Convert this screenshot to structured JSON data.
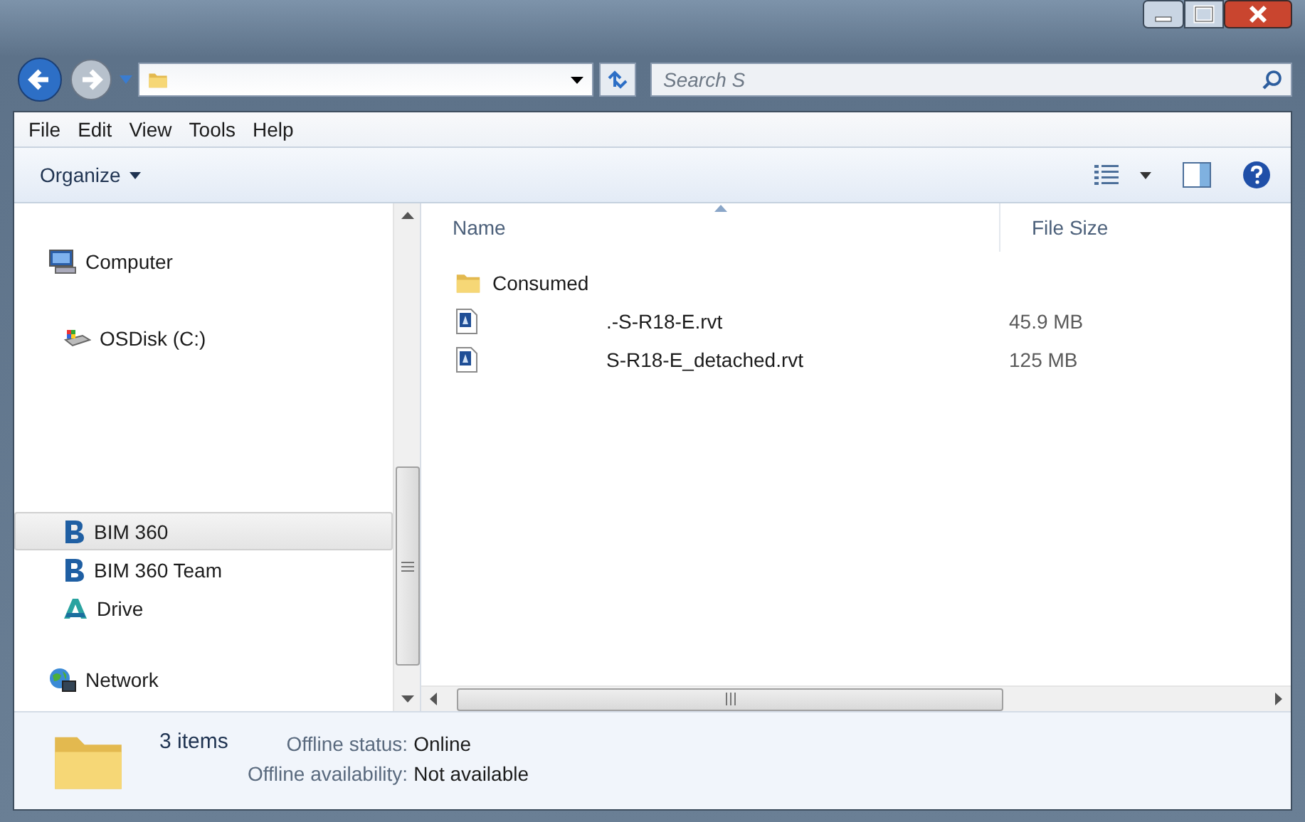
{
  "navigation": {
    "search_placeholder": "Search S"
  },
  "menu": [
    {
      "label": "File"
    },
    {
      "label": "Edit"
    },
    {
      "label": "View"
    },
    {
      "label": "Tools"
    },
    {
      "label": "Help"
    }
  ],
  "toolbar": {
    "organize": "Organize"
  },
  "sidebar": {
    "groups": [
      {
        "items": [
          {
            "label": "Computer",
            "kind": "computer",
            "selected": false
          },
          {
            "label": "OSDisk (C:)",
            "kind": "disk",
            "selected": false
          }
        ]
      },
      {
        "items": [
          {
            "label": "BIM 360",
            "kind": "bim",
            "selected": true
          },
          {
            "label": "BIM 360 Team",
            "kind": "bim",
            "selected": false
          },
          {
            "label": "Drive",
            "kind": "drive",
            "selected": false
          }
        ]
      },
      {
        "items": [
          {
            "label": "Network",
            "kind": "network",
            "selected": false
          }
        ]
      }
    ]
  },
  "file_list": {
    "columns": [
      "Name",
      "File Size"
    ],
    "rows": [
      {
        "name": "Consumed",
        "kind": "folder"
      },
      {
        "name": ".-S-R18-E.rvt",
        "kind": "file",
        "size": "45.9 MB"
      },
      {
        "name": "S-R18-E_detached.rvt",
        "kind": "file",
        "size": "125 MB"
      }
    ]
  },
  "status_bar": {
    "count": "3 items",
    "fields": [
      {
        "label": "Offline status:",
        "value": "Online"
      },
      {
        "label": "Offline availability:",
        "value": "Not available"
      }
    ]
  }
}
